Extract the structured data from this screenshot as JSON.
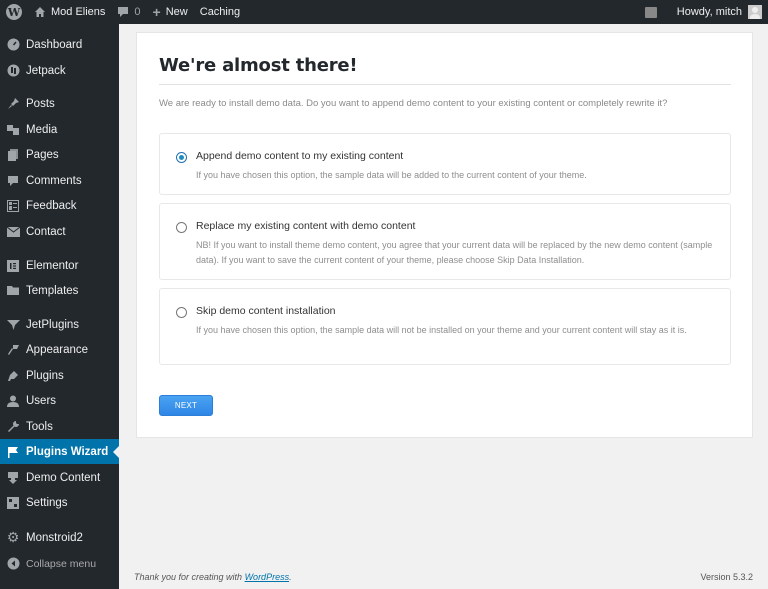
{
  "adminbar": {
    "site_name": "Mod Eliens",
    "comments_count": "0",
    "new_label": "New",
    "caching_label": "Caching",
    "greeting": "Howdy, mitch"
  },
  "sidebar": {
    "items": [
      {
        "label": "Dashboard",
        "icon": "dashboard-icon"
      },
      {
        "label": "Jetpack",
        "icon": "jetpack-icon"
      },
      {
        "label": "Posts",
        "icon": "pin-icon"
      },
      {
        "label": "Media",
        "icon": "media-icon"
      },
      {
        "label": "Pages",
        "icon": "pages-icon"
      },
      {
        "label": "Comments",
        "icon": "comment-icon"
      },
      {
        "label": "Feedback",
        "icon": "feedback-icon"
      },
      {
        "label": "Contact",
        "icon": "mail-icon"
      },
      {
        "label": "Elementor",
        "icon": "elementor-icon"
      },
      {
        "label": "Templates",
        "icon": "folder-icon"
      },
      {
        "label": "JetPlugins",
        "icon": "funnel-icon"
      },
      {
        "label": "Appearance",
        "icon": "brush-icon"
      },
      {
        "label": "Plugins",
        "icon": "plug-icon"
      },
      {
        "label": "Users",
        "icon": "user-icon"
      },
      {
        "label": "Tools",
        "icon": "wrench-icon"
      },
      {
        "label": "Plugins Wizard",
        "icon": "flag-icon",
        "active": true
      },
      {
        "label": "Demo Content",
        "icon": "download-icon"
      },
      {
        "label": "Settings",
        "icon": "settings-icon"
      },
      {
        "label": "Monstroid2",
        "icon": "gear-icon"
      },
      {
        "label": "Collapse menu",
        "icon": "collapse-icon"
      }
    ]
  },
  "main": {
    "title": "We're almost there!",
    "intro": "We are ready to install demo data. Do you want to append demo content to your existing content or completely rewrite it?",
    "options": [
      {
        "label": "Append demo content to my existing content",
        "description": "If you have chosen this option, the sample data will be added to the current content of your theme.",
        "checked": true
      },
      {
        "label": "Replace my existing content with demo content",
        "description": "NB! If you want to install theme demo content, you agree that your current data will be replaced by the new demo content (sample data). If you want to save the current content of your theme, please choose Skip Data Installation.",
        "checked": false
      },
      {
        "label": "Skip demo content installation",
        "description": "If you have chosen this option, the sample data will not be installed on your theme and your current content will stay as it is.",
        "checked": false
      }
    ],
    "next_label": "NEXT"
  },
  "footer": {
    "thanks_prefix": "Thank you for creating with ",
    "thanks_link": "WordPress",
    "thanks_suffix": ".",
    "version": "Version 5.3.2"
  },
  "colors": {
    "adminbar_bg": "#23282d",
    "active_menu": "#0073aa",
    "next_button": "#3a93ec"
  }
}
